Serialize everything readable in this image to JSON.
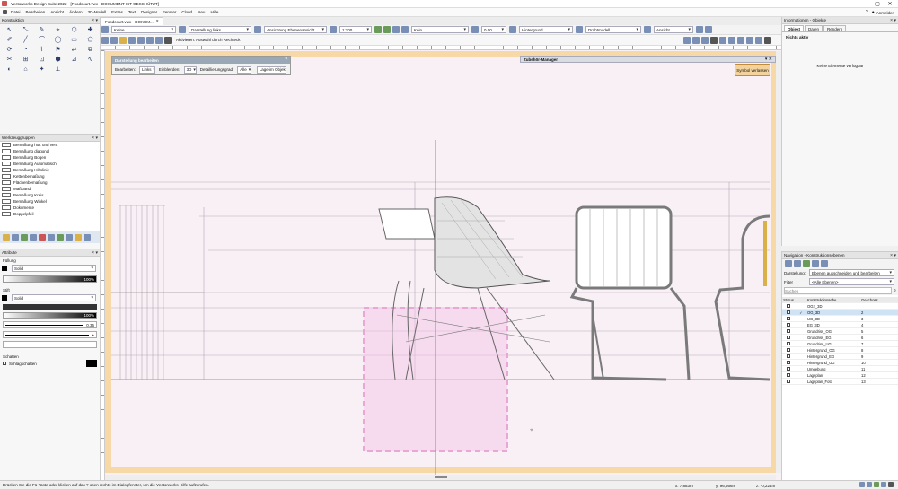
{
  "title_bar": {
    "text": "Vectorworks Design Suite 2022 - [Foodcourt.vwx - DOKUMENT IST GESCHÜTZT]"
  },
  "menu": {
    "items": [
      "Datei",
      "Bearbeiten",
      "Ansicht",
      "Ändern",
      "3D-Modell",
      "Extras",
      "Text",
      "Designer",
      "Fenster",
      "Cloud",
      "Neu",
      "Hilfe"
    ],
    "user": "Anmelden"
  },
  "doc_tab": {
    "label": "Foodcourt.vwx - DOKUM..."
  },
  "toolbar1": {
    "class": "Keine",
    "layer": "Darstellung links",
    "view_combo": "Ansichtung Ebenenansicht",
    "scale": "1:100",
    "fill": "Kein",
    "zoom": "0.00",
    "light": "Hintergrund",
    "render": "Drahtmodell",
    "view": "Ansicht"
  },
  "toolbar2": {
    "hint": "Aktivieren: Auswahl durch Rechteck"
  },
  "construction_panel": {
    "title": "Konstruktion"
  },
  "tools": [
    "↖",
    "⤡",
    "✎",
    "⌖",
    "⬡",
    "✚",
    "✐",
    "╱",
    "⌒",
    "◯",
    "▭",
    "⬠",
    "⟳",
    "◔",
    "⌇",
    "⚑",
    "⇄",
    "⧉",
    "✂",
    "⊞",
    "⊡",
    "⬢",
    "⊿",
    "∿",
    "◐",
    "⌂",
    "✦",
    "⟂"
  ],
  "toolgroup_panel": {
    "title": "Werkzeuggruppen",
    "items": [
      "Bemaßung hor. und vert.",
      "Bemaßung diagonal",
      "Bemaßung Bogen",
      "Bemaßung Automatisch",
      "Bemaßung Hilfslinie",
      "Kettenbemaßung",
      "Flächenbemaßung",
      "Maßband",
      "Bemaßung Kreis",
      "Bemaßung Winkel",
      "Dokumente",
      "Doppelpfeil"
    ]
  },
  "attributes_panel": {
    "title": "Attribute",
    "fill_label": "Füllung",
    "fill_type": "Solid",
    "fill_opacity": "100%",
    "pen_label": "Stift",
    "pen_type": "Solid",
    "pen_opacity": "100%",
    "line_value": "0.35",
    "shadow_label": "Schatten",
    "drop_label": "Schlagschatten"
  },
  "edit_dialog": {
    "title": "Darstellung bearbeiten",
    "items": [
      {
        "label": "Bearbeiten:",
        "value": "Links"
      },
      {
        "label": "Einblenden:",
        "value": "3D"
      },
      {
        "label": "Detaillierungsgrad:",
        "value": "Alle"
      },
      {
        "label": "",
        "value": "Lage im Objekt"
      }
    ]
  },
  "symbol_manager": {
    "title": "Zubehör-Manager"
  },
  "exit_button": {
    "label": "Symbol verlassen"
  },
  "info_panel": {
    "title": "Informationen - Objekte",
    "tabs": [
      "Objekt",
      "Daten",
      "Rendern"
    ],
    "subtitle": "Nichts aktiv",
    "empty_text": "Keine Elemente verfügbar"
  },
  "navigation_panel": {
    "title": "Navigation - Konstruktionsebenen",
    "dropdown_label": "Darstellung:",
    "dropdown_value": "Ebenen ausschneiden und bearbeiten",
    "filter_label": "Filter",
    "filter_value": "<Alle Ebenen>",
    "search_placeholder": "Suchen",
    "columns": [
      "Status",
      "",
      "Konstruktionsebe...",
      "Geschoss"
    ],
    "rows": [
      {
        "name": "OG2_3D",
        "num": "",
        "selected": false
      },
      {
        "name": "OG_3D",
        "num": "2",
        "selected": true
      },
      {
        "name": "UG_3D",
        "num": "3",
        "selected": false
      },
      {
        "name": "EG_3D",
        "num": "4",
        "selected": false
      },
      {
        "name": "Grundriss_OG",
        "num": "5",
        "selected": false
      },
      {
        "name": "Grundriss_EG",
        "num": "6",
        "selected": false
      },
      {
        "name": "Grundriss_UG",
        "num": "7",
        "selected": false
      },
      {
        "name": "Hintergrund_OG",
        "num": "8",
        "selected": false
      },
      {
        "name": "Hintergrund_EG",
        "num": "9",
        "selected": false
      },
      {
        "name": "Hintergrund_UG",
        "num": "10",
        "selected": false
      },
      {
        "name": "Umgebung",
        "num": "11",
        "selected": false
      },
      {
        "name": "Lageplan",
        "num": "12",
        "selected": false
      },
      {
        "name": "Lageplan_Foto",
        "num": "13",
        "selected": false
      }
    ]
  },
  "status_bar": {
    "hint": "Drücken Sie die F1-Taste oder klicken auf das ? oben rechts im Dialogfenster, um die Vectorworks-Hilfe aufzurufen.",
    "x": "x: 7,883m",
    "y": "y: 96,666m",
    "z": "z: -0,224m"
  },
  "colors": {
    "accent": "#f7d9a8",
    "selection": "#e9a7d6",
    "green": "#37c84a"
  }
}
